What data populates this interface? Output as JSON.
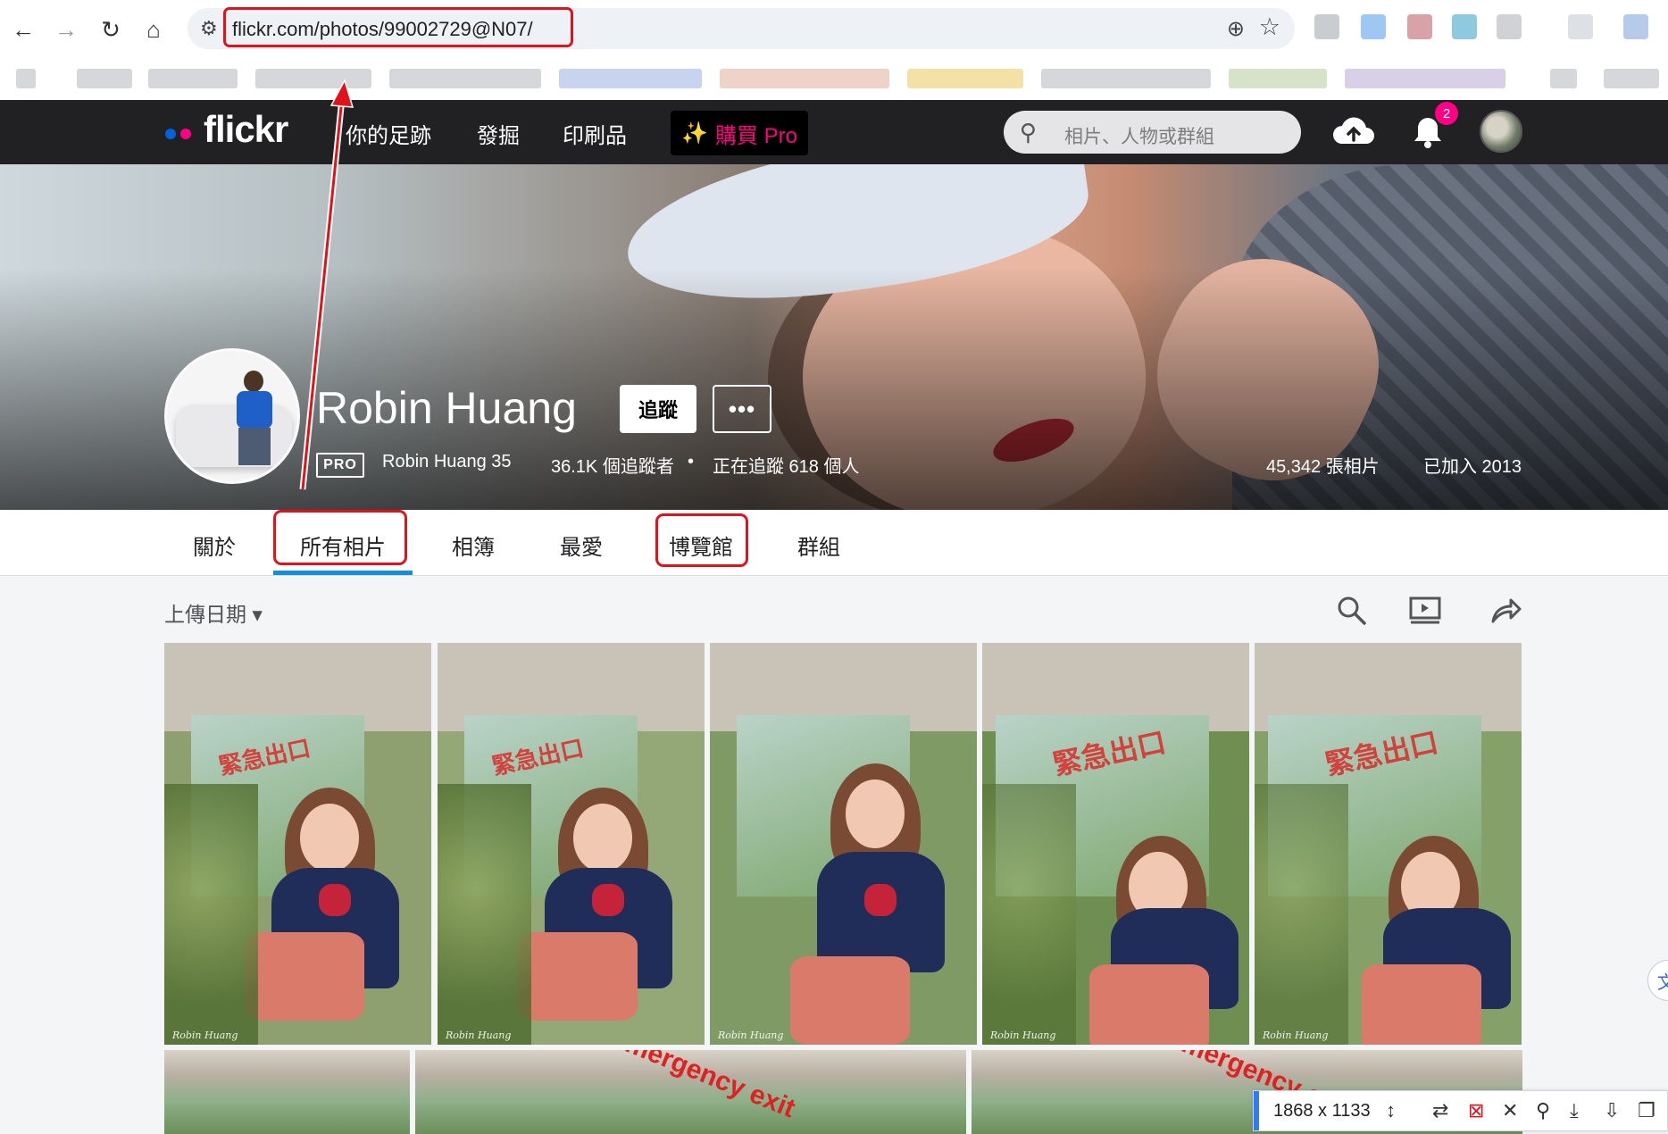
{
  "browser": {
    "url": "flickr.com/photos/99002729@N07/",
    "icons": [
      "back-icon",
      "forward-icon",
      "reload-icon",
      "home-icon",
      "tune-icon",
      "zoom-icon",
      "star-icon"
    ]
  },
  "flickr_nav": {
    "logo": "flickr",
    "items": [
      "你的足跡",
      "發掘",
      "印刷品"
    ],
    "pro_label": "購買 Pro",
    "search_placeholder": "相片、人物或群組",
    "notifications_count": "2",
    "colors": {
      "blue_dot": "#0063dc",
      "pink_dot": "#ff0084"
    }
  },
  "profile": {
    "name": "Robin Huang",
    "follow_label": "追蹤",
    "more_label": "•••",
    "pro_badge": "PRO",
    "username": "Robin Huang 35",
    "followers": "36.1K 個追蹤者",
    "separator": "•",
    "following": "正在追蹤 618 個人",
    "photo_count": "45,342 張相片",
    "joined": "已加入 2013"
  },
  "tabs": [
    "關於",
    "所有相片",
    "相簿",
    "最愛",
    "博覽館",
    "群組"
  ],
  "toolbar": {
    "sort_label": "上傳日期",
    "sort_caret": "▾"
  },
  "photos": {
    "signature": "Robin Huang",
    "row1_count": 5,
    "row2_count": 3
  },
  "overlay": {
    "dimensions": "1868 x 1133",
    "translate_glyph": "文"
  }
}
